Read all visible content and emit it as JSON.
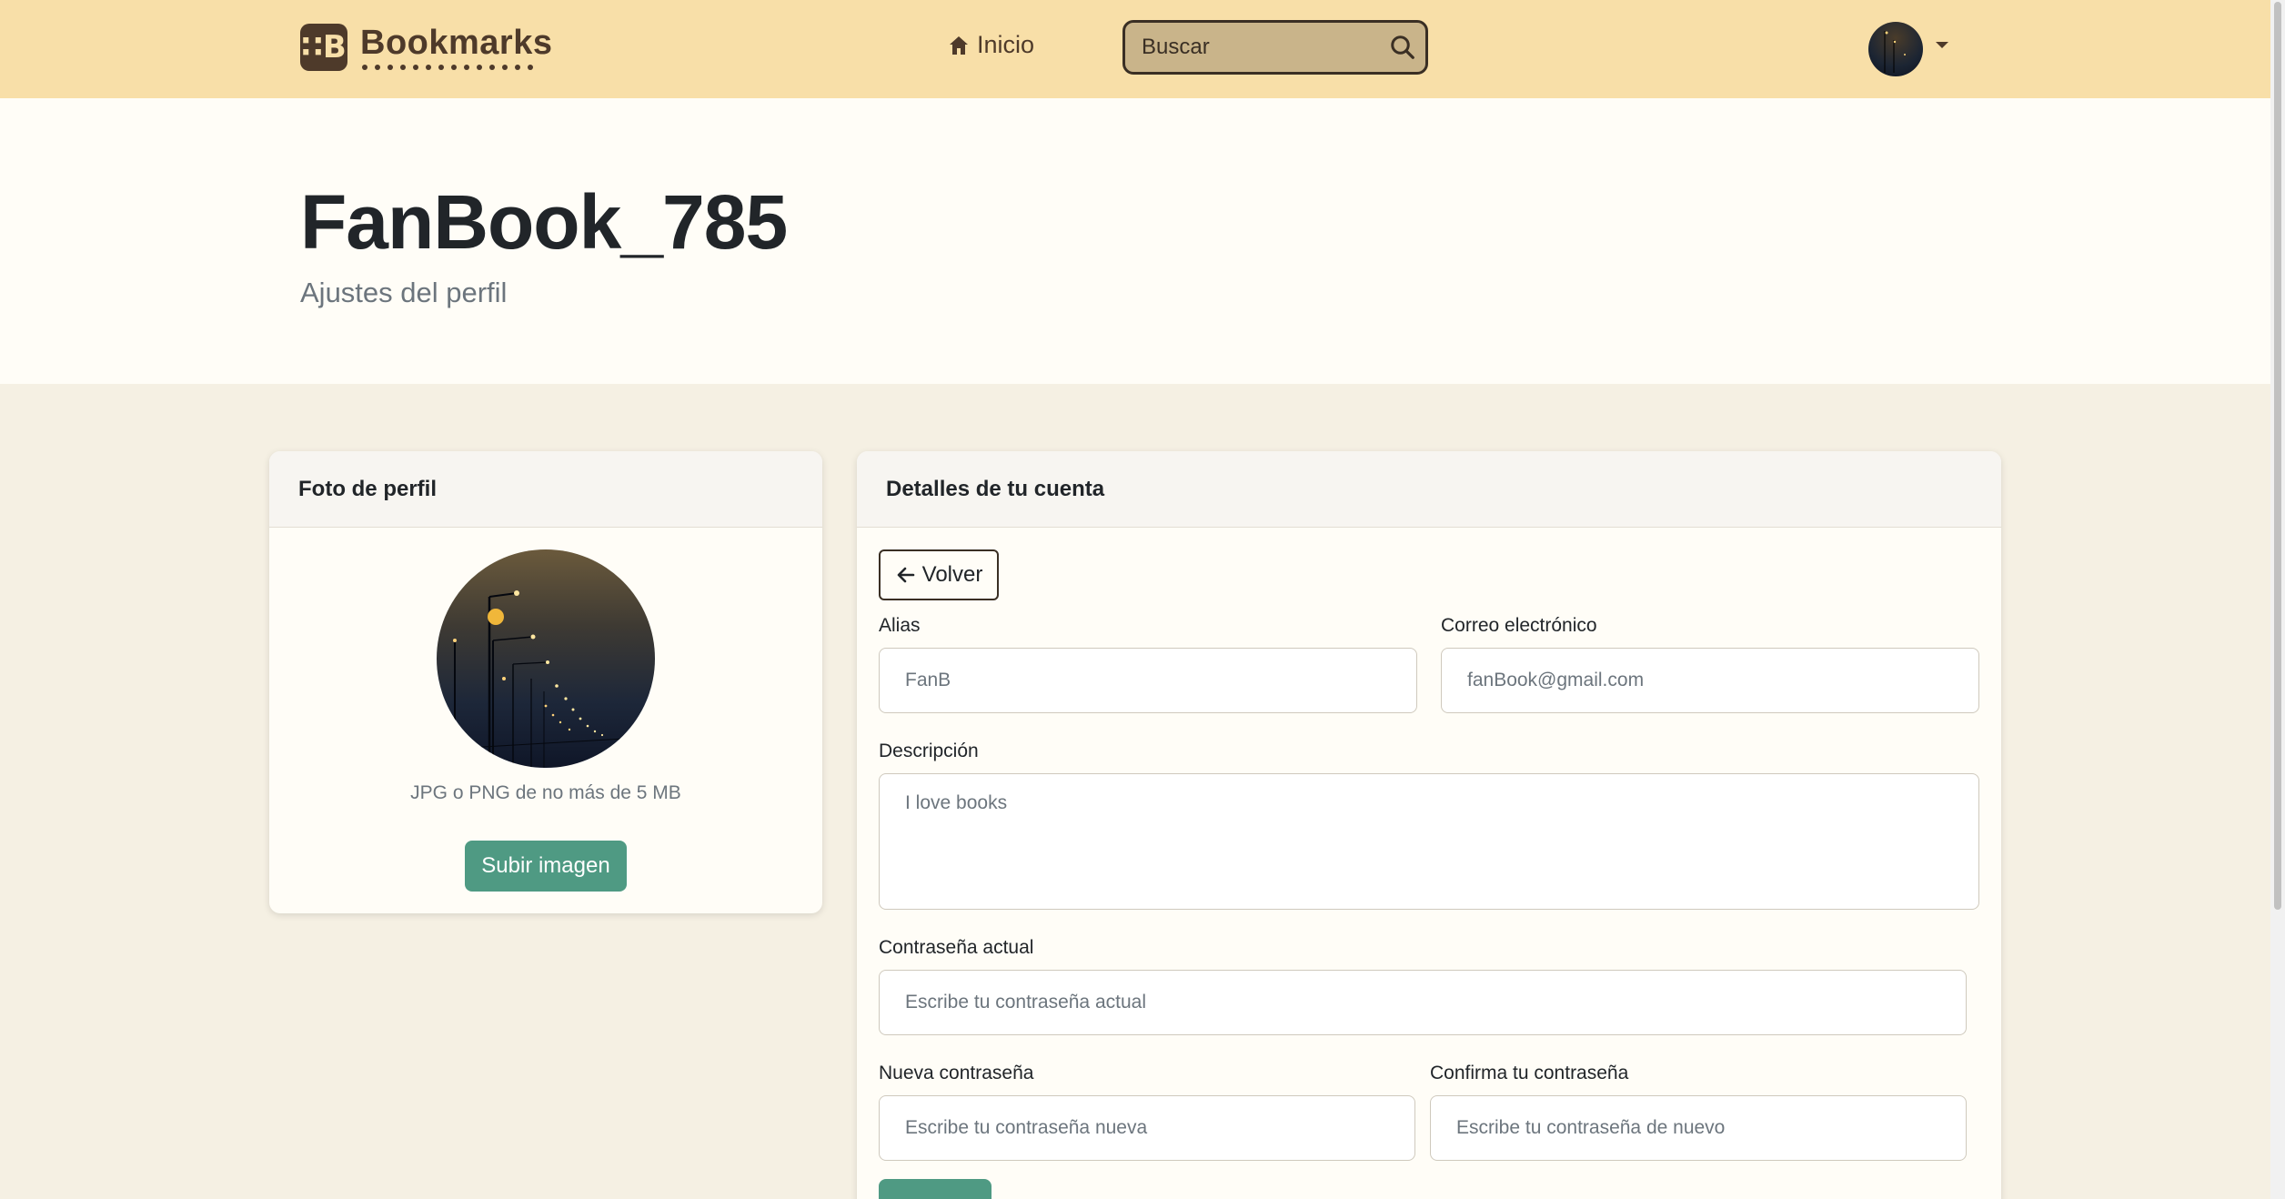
{
  "navbar": {
    "brand_logo_text": "∷B",
    "brand_name": "Bookmarks",
    "home_label": "Inicio",
    "search_placeholder": "Buscar"
  },
  "header": {
    "title": "FanBook_785",
    "subtitle": "Ajustes del perfil"
  },
  "photo_card": {
    "title": "Foto de perfil",
    "hint": "JPG o PNG de no más de 5 MB",
    "upload_label": "Subir imagen"
  },
  "details_card": {
    "title": "Detalles de tu cuenta",
    "back_label": "Volver",
    "alias_label": "Alias",
    "alias_placeholder": "FanB",
    "email_label": "Correo electrónico",
    "email_placeholder": "fanBook@gmail.com",
    "description_label": "Descripción",
    "description_placeholder": "I love books",
    "current_password_label": "Contraseña actual",
    "current_password_placeholder": "Escribe tu contraseña actual",
    "new_password_label": "Nueva contraseña",
    "new_password_placeholder": "Escribe tu contraseña nueva",
    "confirm_password_label": "Confirma tu contraseña",
    "confirm_password_placeholder": "Escribe tu contraseña de nuevo"
  },
  "colors": {
    "navbar_bg": "#f8dfa8",
    "brand": "#4e3a2a",
    "accent_button": "#4f9a83",
    "page_bg": "#f5f0e3"
  }
}
